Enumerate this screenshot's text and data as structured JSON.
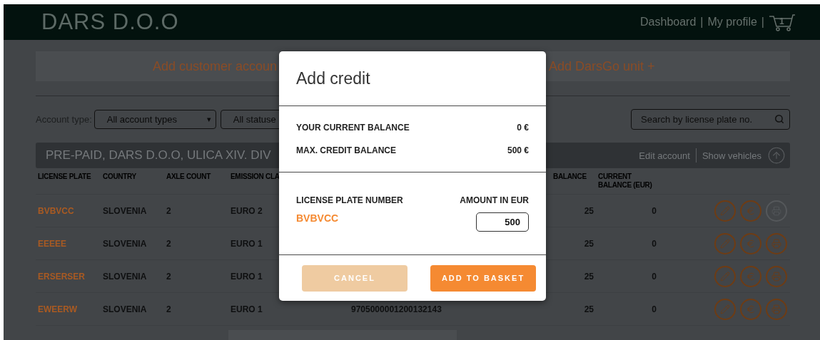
{
  "header": {
    "title": "DARS D.O.O",
    "nav": [
      {
        "label": "Dashboard",
        "separator": "|"
      },
      {
        "label": "My profile",
        "separator": "|"
      }
    ],
    "cart": {
      "count": "1"
    }
  },
  "actions": [
    {
      "label": "Add customer accoun"
    },
    {
      "label": "Add DarsGo unit +"
    }
  ],
  "filters": {
    "label": "Account type:",
    "selects": [
      {
        "value": "All account types",
        "caret": "▾"
      },
      {
        "value": "All statuse"
      }
    ],
    "search": {
      "placeholder": "Search by license plate no."
    }
  },
  "account": {
    "title": "PRE-PAID, DARS D.O.O, ULICA XIV. DIV",
    "links": [
      {
        "label": "Edit account"
      },
      {
        "label": "Show vehicles"
      }
    ]
  },
  "table": {
    "columns": [
      "LICENSE PLATE",
      "COUNTRY",
      "AXLE COUNT",
      "EMISSION CLA",
      "",
      "BALANCE",
      "CURRENT BALANCE (EUR)"
    ],
    "rows": [
      {
        "plate": "BVBVCC",
        "country": "SLOVENIA",
        "axles": "2",
        "emission": "EURO 2",
        "number": "",
        "balance": "25",
        "current": "0",
        "print_enabled": false
      },
      {
        "plate": "EEEEE",
        "country": "SLOVENIA",
        "axles": "2",
        "emission": "EURO 1",
        "number": "",
        "balance": "25",
        "current": "0",
        "print_enabled": true
      },
      {
        "plate": "ERSERSER",
        "country": "SLOVENIA",
        "axles": "2",
        "emission": "EURO 1",
        "number": "",
        "balance": "25",
        "current": "0",
        "print_enabled": true
      },
      {
        "plate": "EWEERW",
        "country": "SLOVENIA",
        "axles": "2",
        "emission": "EURO 1",
        "number": "9705000001200132143",
        "balance": "25",
        "current": "0",
        "print_enabled": true
      }
    ]
  },
  "modal": {
    "title": "Add credit",
    "summary": [
      {
        "label": "YOUR CURRENT BALANCE",
        "value": "0 €"
      },
      {
        "label": "MAX. CREDIT BALANCE",
        "value": "500 €"
      }
    ],
    "plate_label": "LICENSE PLATE NUMBER",
    "amount_label": "AMOUNT IN EUR",
    "plate": "BVBVCC",
    "amount": "500",
    "buttons": [
      {
        "label": "CANCEL",
        "kind": "secondary"
      },
      {
        "label": "ADD TO BASKET",
        "kind": "primary"
      }
    ]
  }
}
